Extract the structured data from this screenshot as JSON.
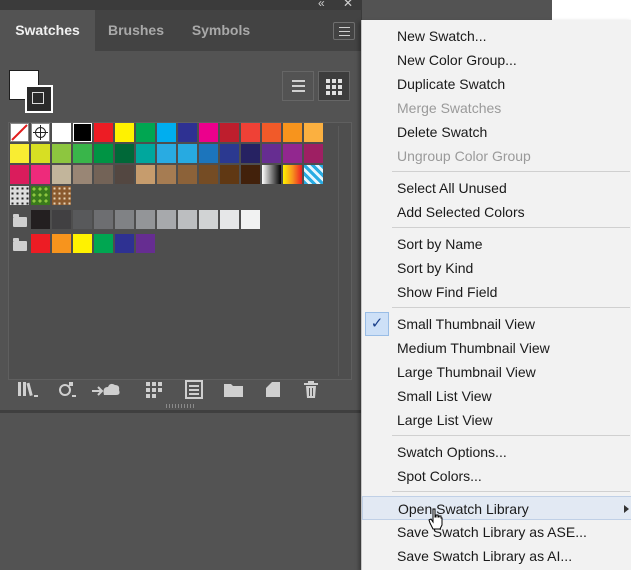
{
  "panel": {
    "tabs": [
      {
        "label": "Swatches",
        "active": true
      },
      {
        "label": "Brushes",
        "active": false
      },
      {
        "label": "Symbols",
        "active": false
      }
    ],
    "icons": {
      "collapse": "double-chevron-left-icon",
      "close": "close-icon",
      "panel_menu": "hamburger-menu-icon"
    },
    "swatch_rows": [
      [
        "none",
        "registration",
        "#ffffff",
        "#000000",
        "#ed1c24",
        "#fff200",
        "#00a651",
        "#00aeef",
        "#2e3192",
        "#ec008c",
        "#be1e2d",
        "#ef4136",
        "#f15a29",
        "#f7941d",
        "#fbb040"
      ],
      [
        "#f9ed32",
        "#d7df23",
        "#8dc63f",
        "#39b54a",
        "#009444",
        "#006838",
        "#00a79d",
        "#29abe2",
        "#27aae1",
        "#1c75bc",
        "#2b3990",
        "#262262",
        "#662d91",
        "#92278f",
        "#9e1f63"
      ],
      [
        "#da1c5c",
        "#ee2a7b",
        "#c2b59b",
        "#998675",
        "#736357",
        "#534741",
        "#c69c6d",
        "#a67c52",
        "#8c6239",
        "#754c24",
        "#603813",
        "#42210b",
        "gradient-bw",
        "gradient-orange",
        "gradient-blue"
      ],
      [
        "pattern-dots",
        "pattern-leaves",
        "pattern-pebbles"
      ],
      [
        "folder",
        "#231f20",
        "#414042",
        "#58595b",
        "#6d6e71",
        "#808285",
        "#939598",
        "#a7a9ac",
        "#bcbec0",
        "#d1d3d4",
        "#e6e7e8",
        "#f1f2f2"
      ],
      [
        "folder",
        "#ed1c24",
        "#f7941d",
        "#fff200",
        "#00a651",
        "#2e3192",
        "#662d91"
      ]
    ],
    "bottom_icons": [
      "swatch-libraries-menu-icon",
      "show-kinds-icon",
      "place-swatches-cc-icon",
      "swatch-options-grid-icon",
      "new-color-group-icon",
      "folder-icon",
      "new-swatch-icon",
      "delete-trash-icon"
    ]
  },
  "menu": {
    "groups": [
      [
        {
          "label": "New Swatch...",
          "enabled": true
        },
        {
          "label": "New Color Group...",
          "enabled": true
        },
        {
          "label": "Duplicate Swatch",
          "enabled": true
        },
        {
          "label": "Merge Swatches",
          "enabled": false
        },
        {
          "label": "Delete Swatch",
          "enabled": true
        },
        {
          "label": "Ungroup Color Group",
          "enabled": false
        }
      ],
      [
        {
          "label": "Select All Unused",
          "enabled": true
        },
        {
          "label": "Add Selected Colors",
          "enabled": true
        }
      ],
      [
        {
          "label": "Sort by Name",
          "enabled": true
        },
        {
          "label": "Sort by Kind",
          "enabled": true
        },
        {
          "label": "Show Find Field",
          "enabled": true
        }
      ],
      [
        {
          "label": "Small Thumbnail View",
          "enabled": true,
          "checked": true
        },
        {
          "label": "Medium Thumbnail View",
          "enabled": true
        },
        {
          "label": "Large Thumbnail View",
          "enabled": true
        },
        {
          "label": "Small List View",
          "enabled": true
        },
        {
          "label": "Large List View",
          "enabled": true
        }
      ],
      [
        {
          "label": "Swatch Options...",
          "enabled": true
        },
        {
          "label": "Spot Colors...",
          "enabled": true
        }
      ],
      [
        {
          "label": "Open Swatch Library",
          "enabled": true,
          "submenu": true,
          "hover": true
        },
        {
          "label": "Save Swatch Library as ASE...",
          "enabled": true
        },
        {
          "label": "Save Swatch Library as AI...",
          "enabled": true
        }
      ]
    ]
  }
}
